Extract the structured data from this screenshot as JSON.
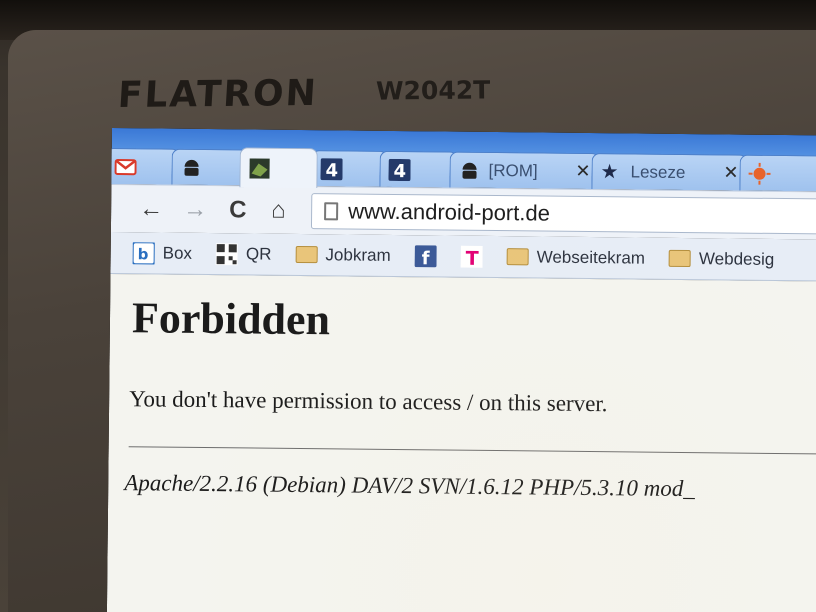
{
  "monitor": {
    "brand": "FLATRON",
    "model": "W2042T"
  },
  "tabs": [
    {
      "icon": "gmail-icon",
      "label": ""
    },
    {
      "icon": "android-icon",
      "label": ""
    },
    {
      "icon": "site-icon",
      "label": "",
      "active": true
    },
    {
      "icon": "channel4-icon",
      "label": ""
    },
    {
      "icon": "channel4-icon",
      "label": ""
    },
    {
      "icon": "android-icon",
      "label": "[ROM]"
    },
    {
      "icon": "star-icon",
      "label": "Leseze"
    },
    {
      "icon": "sun-icon",
      "label": ""
    }
  ],
  "toolbar": {
    "back": "←",
    "forward": "→",
    "reload": "C",
    "home": "⌂"
  },
  "address_bar": {
    "url": "www.android-port.de"
  },
  "bookmarks": [
    {
      "icon": "box-icon",
      "label": "Box"
    },
    {
      "icon": "qr-icon",
      "label": "QR"
    },
    {
      "icon": "folder-icon",
      "label": "Jobkram"
    },
    {
      "icon": "facebook-icon",
      "label": ""
    },
    {
      "icon": "telekom-icon",
      "label": ""
    },
    {
      "icon": "folder-icon",
      "label": "Webseitekram"
    },
    {
      "icon": "folder-icon",
      "label": "Webdesig"
    }
  ],
  "page": {
    "title": "Forbidden",
    "message": "You don't have permission to access / on this server.",
    "server_signature": "Apache/2.2.16 (Debian) DAV/2 SVN/1.6.12 PHP/5.3.10 mod_"
  },
  "colors": {
    "tabstrip": "#3a78d6",
    "page_bg": "#f4f4ef",
    "gmail_red": "#d93a2b",
    "facebook_blue": "#3b5998",
    "telekom_magenta": "#e20074"
  }
}
